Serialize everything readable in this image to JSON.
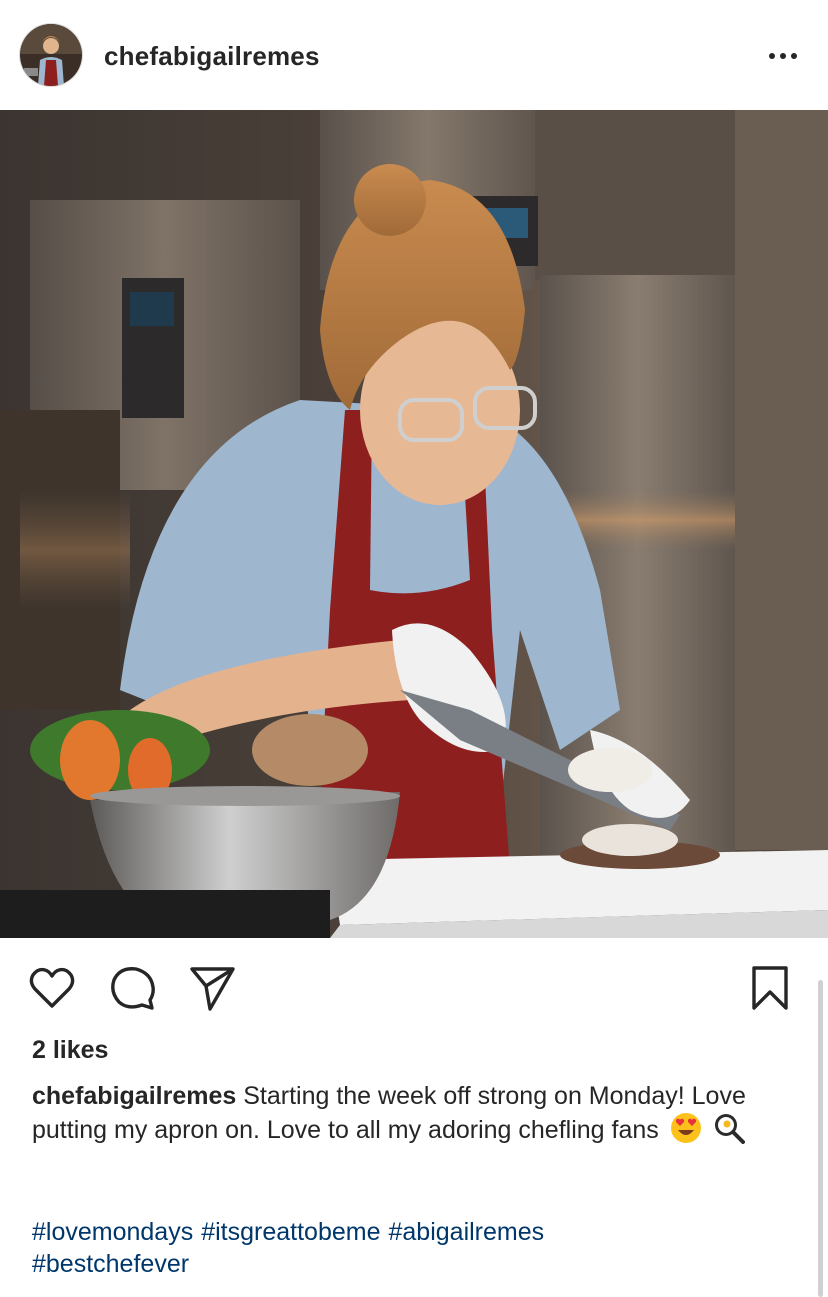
{
  "post": {
    "username": "chefabigailremes",
    "more_icon": "more-horizontal-icon",
    "likes_text": "2 likes",
    "caption": {
      "username": "chefabigailremes",
      "text": "Starting the week off strong on Monday! Love putting my apron on. Love to all my adoring chefling fans",
      "emojis": [
        "heart-eyes-emoji",
        "frying-pan-egg-emoji"
      ]
    },
    "hashtags": [
      "#lovemondays",
      "#itsgreattobeme",
      "#abigailremes",
      "#bestchefever"
    ]
  },
  "actions": {
    "like_icon": "heart-icon",
    "comment_icon": "comment-icon",
    "share_icon": "paper-plane-icon",
    "save_icon": "bookmark-icon"
  },
  "colors": {
    "text": "#262626",
    "hashtag": "#00376b",
    "apron": "#8e1f1f",
    "shirt": "#9fb6cf"
  }
}
